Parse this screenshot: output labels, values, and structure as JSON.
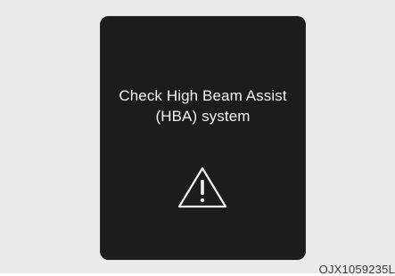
{
  "display": {
    "message_line1": "Check High Beam Assist",
    "message_line2": "(HBA) system",
    "icon": "warning-triangle-icon"
  },
  "caption": {
    "code": "OJX1059235L"
  },
  "colors": {
    "background": "#ebebeb",
    "screen": "#1c1c1c",
    "text": "#f2f2f2"
  }
}
